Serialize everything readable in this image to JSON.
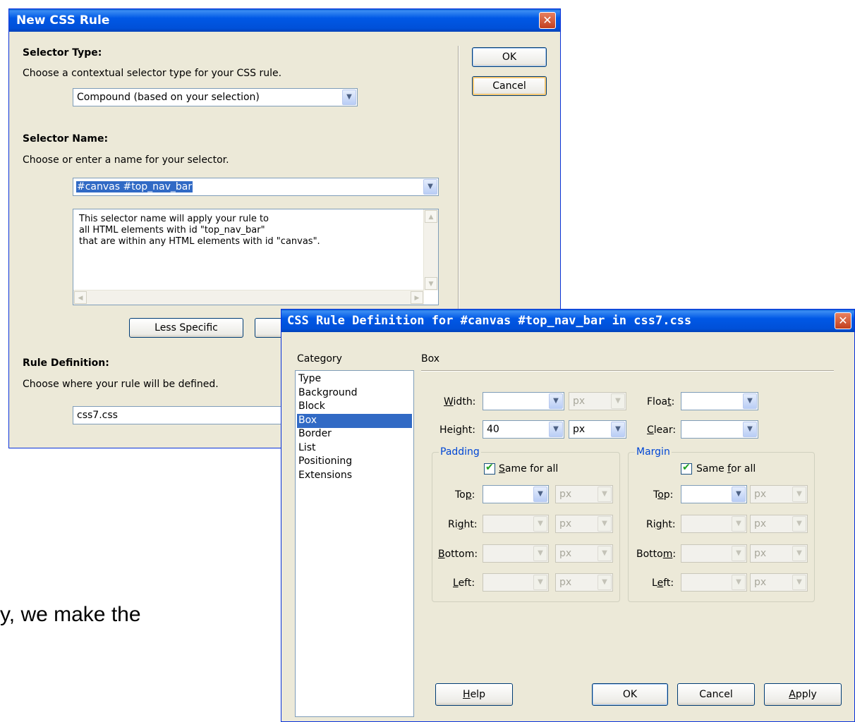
{
  "new_rule_dialog": {
    "title": "New CSS Rule",
    "close_glyph": "✕",
    "selector_type": {
      "heading": "Selector Type:",
      "description": "Choose a contextual selector type for your CSS rule.",
      "value": "Compound (based on your selection)"
    },
    "selector_name": {
      "heading": "Selector Name:",
      "description": "Choose or enter a name for your selector.",
      "value": "#canvas #top_nav_bar",
      "info_lines": [
        "This selector name will apply your rule to",
        "all HTML elements with id \"top_nav_bar\"",
        "that are within any HTML elements with id \"canvas\"."
      ],
      "less_specific_label": "Less Specific"
    },
    "rule_definition": {
      "heading": "Rule Definition:",
      "description": "Choose where your rule will be defined.",
      "value": "css7.css"
    },
    "ok_label": "OK",
    "cancel_label": "Cancel"
  },
  "definition_dialog": {
    "title": "CSS Rule Definition for #canvas #top_nav_bar in css7.css",
    "close_glyph": "✕",
    "category_heading": "Category",
    "categories": [
      "Type",
      "Background",
      "Block",
      "Box",
      "Border",
      "List",
      "Positioning",
      "Extensions"
    ],
    "selected_category": "Box",
    "panel_title": "Box",
    "width": {
      "label_pre": "",
      "label_key": "W",
      "label_post": "idth:",
      "value": "",
      "unit": "px"
    },
    "height": {
      "label_pre": "Hei",
      "label_key": "g",
      "label_post": "ht:",
      "value": "40",
      "unit": "px"
    },
    "float": {
      "label_pre": "Floa",
      "label_key": "t",
      "label_post": ":",
      "value": ""
    },
    "clear": {
      "label_pre": "",
      "label_key": "C",
      "label_post": "lear:",
      "value": ""
    },
    "padding": {
      "legend": "Padding",
      "same_pre": "",
      "same_key": "S",
      "same_post": "ame for all",
      "top": {
        "pre": "To",
        "key": "p",
        "post": ":",
        "unit": "px"
      },
      "right": {
        "pre": "Ri",
        "key": "g",
        "post": "ht:",
        "unit": "px"
      },
      "bottom": {
        "pre": "",
        "key": "B",
        "post": "ottom:",
        "unit": "px"
      },
      "left": {
        "pre": "",
        "key": "L",
        "post": "eft:",
        "unit": "px"
      }
    },
    "margin": {
      "legend": "Margin",
      "same_pre": "Same ",
      "same_key": "f",
      "same_post": "or all",
      "top": {
        "pre": "T",
        "key": "o",
        "post": "p:",
        "unit": "px"
      },
      "right": {
        "pre": "Ri",
        "key": "g",
        "post": "ht:",
        "unit": "px"
      },
      "bottom": {
        "pre": "Botto",
        "key": "m",
        "post": ":",
        "unit": "px"
      },
      "left": {
        "pre": "L",
        "key": "e",
        "post": "ft:",
        "unit": "px"
      }
    },
    "help": {
      "key": "H",
      "post": "elp"
    },
    "ok_label": "OK",
    "cancel_label": "Cancel",
    "apply": {
      "key": "A",
      "post": "pply"
    }
  },
  "background_text": "y, we make the",
  "arrow_glyph": "▼",
  "check_glyph": "✔",
  "scroll_up": "▲",
  "scroll_down": "▼",
  "scroll_left": "◀",
  "scroll_right": "▶"
}
